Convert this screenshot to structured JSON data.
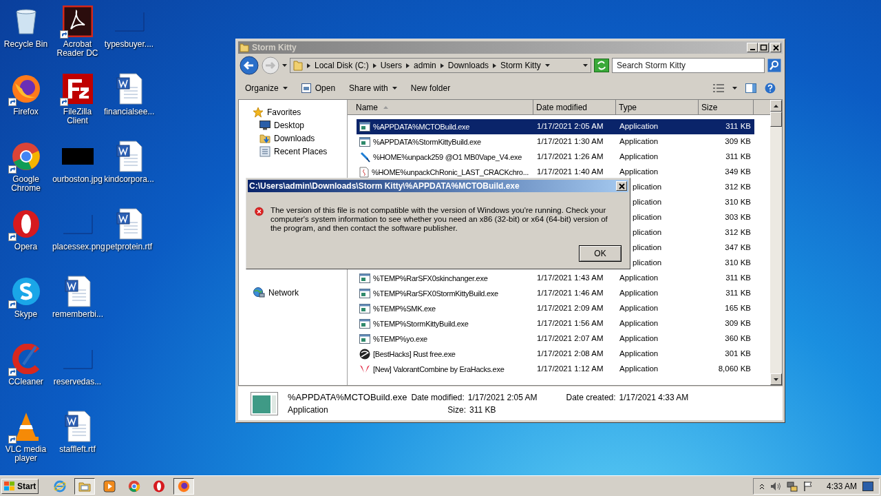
{
  "desktop_columns": [
    [
      {
        "label": "Recycle Bin",
        "kind": "recycle"
      },
      {
        "label": "Firefox",
        "kind": "firefox"
      },
      {
        "label": "Google Chrome",
        "kind": "chrome"
      },
      {
        "label": "Opera",
        "kind": "opera"
      },
      {
        "label": "Skype",
        "kind": "skype"
      },
      {
        "label": "CCleaner",
        "kind": "ccleaner"
      },
      {
        "label": "VLC media player",
        "kind": "vlc"
      }
    ],
    [
      {
        "label": "Acrobat Reader DC",
        "kind": "acrobat"
      },
      {
        "label": "FileZilla Client",
        "kind": "filezilla"
      },
      {
        "label": "ourboston.jpg",
        "kind": "black"
      },
      {
        "label": "placessex.png",
        "kind": "blank"
      },
      {
        "label": "rememberbi...",
        "kind": "doc"
      },
      {
        "label": "reservedas...",
        "kind": "blank"
      },
      {
        "label": "staffleft.rtf",
        "kind": "doc"
      }
    ],
    [
      {
        "label": "typesbuyer....",
        "kind": "blank"
      },
      {
        "label": "financialsee...",
        "kind": "doc"
      },
      {
        "label": "kindcorpora...",
        "kind": "doc"
      },
      {
        "label": "petprotein.rtf",
        "kind": "doc"
      }
    ]
  ],
  "explorer": {
    "title": "Storm Kitty",
    "breadcrumbs": [
      "Local Disk (C:)",
      "Users",
      "admin",
      "Downloads",
      "Storm Kitty"
    ],
    "search": {
      "placeholder": "Search Storm Kitty"
    },
    "commands": [
      {
        "label": "Organize",
        "kind": "menu"
      },
      {
        "label": "Open",
        "kind": "icon"
      },
      {
        "label": "Share with",
        "kind": "menu"
      },
      {
        "label": "New folder",
        "kind": "plain"
      }
    ],
    "nav": [
      {
        "label": "Favorites",
        "kind": "star"
      },
      {
        "label": "Desktop",
        "kind": "desktop"
      },
      {
        "label": "Downloads",
        "kind": "downloads"
      },
      {
        "label": "Recent Places",
        "kind": "recent"
      },
      {
        "label": "Network",
        "kind": "network"
      }
    ],
    "columns": [
      "Name",
      "Date modified",
      "Type",
      "Size"
    ],
    "rows": [
      {
        "kind": "app",
        "name": "%APPDATA%MCTOBuild.exe",
        "date": "1/17/2021 2:05 AM",
        "type": "Application",
        "size": "311 KB",
        "selected": true
      },
      {
        "kind": "app",
        "name": "%APPDATA%StormKittyBuild.exe",
        "date": "1/17/2021 1:30 AM",
        "type": "Application",
        "size": "309 KB",
        "selected": false
      },
      {
        "kind": "brush",
        "name": "%HOME%unpack259 @O1 MB0Vape_V4.exe",
        "date": "1/17/2021 1:26 AM",
        "type": "Application",
        "size": "311 KB",
        "selected": false
      },
      {
        "kind": "script",
        "name": "%HOME%unpackChRonic_LAST_CRACKchro...",
        "date": "1/17/2021 1:40 AM",
        "type": "Application",
        "size": "349 KB",
        "selected": false
      },
      {
        "kind": "covered",
        "type": "plication",
        "size": "312 KB",
        "selected": false
      },
      {
        "kind": "covered",
        "type": "plication",
        "size": "310 KB",
        "selected": false
      },
      {
        "kind": "covered",
        "type": "plication",
        "size": "303 KB",
        "selected": false
      },
      {
        "kind": "covered",
        "type": "plication",
        "size": "312 KB",
        "selected": false
      },
      {
        "kind": "covered",
        "type": "plication",
        "size": "347 KB",
        "selected": false
      },
      {
        "kind": "covered",
        "type": "plication",
        "size": "310 KB",
        "selected": false
      },
      {
        "kind": "app",
        "name": "%TEMP%RarSFX0skinchanger.exe",
        "date": "1/17/2021 1:43 AM",
        "type": "Application",
        "size": "311 KB",
        "selected": false
      },
      {
        "kind": "app",
        "name": "%TEMP%RarSFX0StormKittyBuild.exe",
        "date": "1/17/2021 1:46 AM",
        "type": "Application",
        "size": "311 KB",
        "selected": false
      },
      {
        "kind": "app",
        "name": "%TEMP%SMK.exe",
        "date": "1/17/2021 2:09 AM",
        "type": "Application",
        "size": "165 KB",
        "selected": false
      },
      {
        "kind": "app",
        "name": "%TEMP%StormKittyBuild.exe",
        "date": "1/17/2021 1:56 AM",
        "type": "Application",
        "size": "309 KB",
        "selected": false
      },
      {
        "kind": "app",
        "name": "%TEMP%yo.exe",
        "date": "1/17/2021 2:07 AM",
        "type": "Application",
        "size": "360 KB",
        "selected": false
      },
      {
        "kind": "globe",
        "name": "[BestHacks] Rust free.exe",
        "date": "1/17/2021 2:08 AM",
        "type": "Application",
        "size": "301 KB",
        "selected": false
      },
      {
        "kind": "wings",
        "name": "[New] ValorantCombine by EraHacks.exe",
        "date": "1/17/2021 1:12 AM",
        "type": "Application",
        "size": "8,060 KB",
        "selected": false
      }
    ],
    "details": {
      "name": "%APPDATA%MCTOBuild.exe",
      "type": "Application",
      "modified_label": "Date modified:",
      "modified": "1/17/2021 2:05 AM",
      "created_label": "Date created:",
      "created": "1/17/2021 4:33 AM",
      "size_label": "Size:",
      "size": "311 KB"
    }
  },
  "dialog": {
    "title": "C:\\Users\\admin\\Downloads\\Storm Kitty\\%APPDATA%MCTOBuild.exe",
    "message": "The version of this file is not compatible with the version of Windows you're running. Check your computer's system information to see whether you need an x86 (32-bit) or x64 (64-bit) version of the program, and then contact the software publisher.",
    "button": "OK"
  },
  "taskbar": {
    "start": "Start",
    "apps": [
      {
        "kind": "ie",
        "active": false
      },
      {
        "kind": "explorer",
        "active": true
      },
      {
        "kind": "media",
        "active": false
      },
      {
        "kind": "chrome",
        "active": false
      },
      {
        "kind": "opera",
        "active": false
      },
      {
        "kind": "firefox",
        "active": true
      }
    ],
    "time": "4:33 AM"
  }
}
